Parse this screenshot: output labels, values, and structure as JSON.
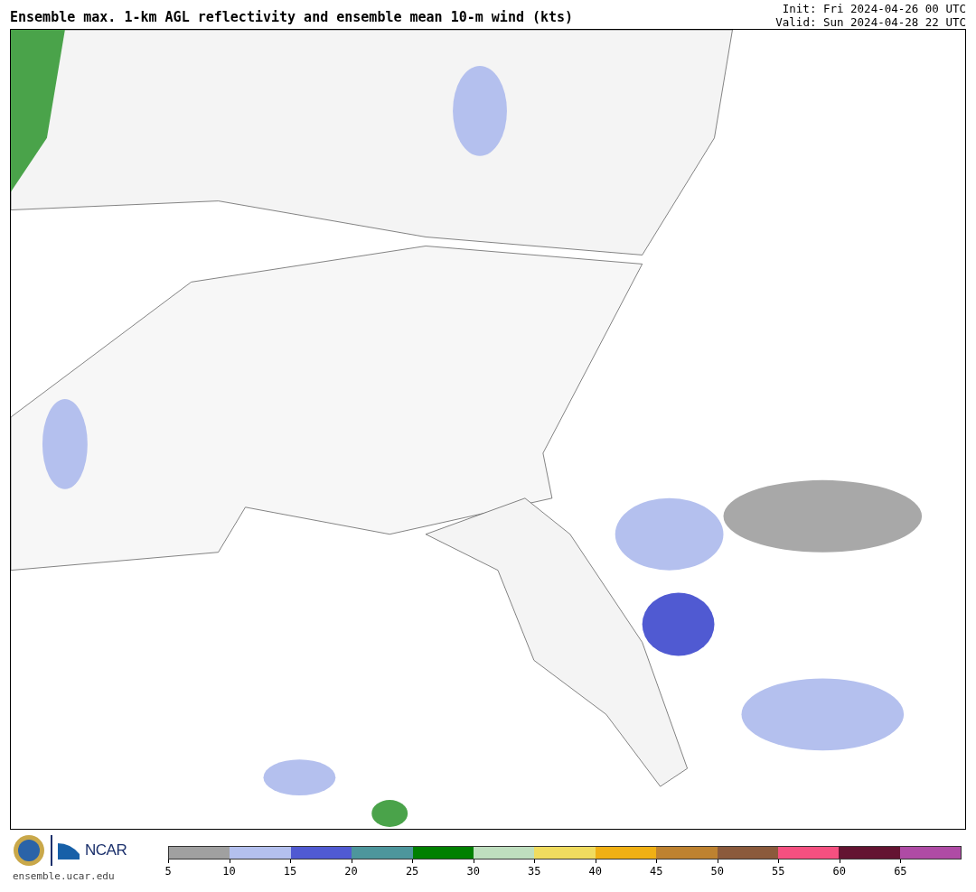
{
  "title": "Ensemble max. 1-km AGL reflectivity and ensemble mean 10-m wind (kts)",
  "init": "Init: Fri 2024-04-26 00 UTC",
  "valid": "Valid: Sun 2024-04-28 22 UTC",
  "logo": {
    "text": "NCAR",
    "site": "ensemble.ucar.edu"
  },
  "colorbar": {
    "bins": [
      {
        "color": "#a0a0a0"
      },
      {
        "color": "#b4c0ee"
      },
      {
        "color": "#505ad2"
      },
      {
        "color": "#4d969c"
      },
      {
        "color": "#008000"
      },
      {
        "color": "#bfdfbf"
      },
      {
        "color": "#f0dc5f"
      },
      {
        "color": "#f0b014"
      },
      {
        "color": "#be8230"
      },
      {
        "color": "#8b5a3c"
      },
      {
        "color": "#f55080"
      },
      {
        "color": "#641432"
      },
      {
        "color": "#af4ba5"
      }
    ],
    "ticks": [
      "5",
      "10",
      "15",
      "20",
      "25",
      "30",
      "35",
      "40",
      "45",
      "50",
      "55",
      "60",
      "65"
    ]
  }
}
